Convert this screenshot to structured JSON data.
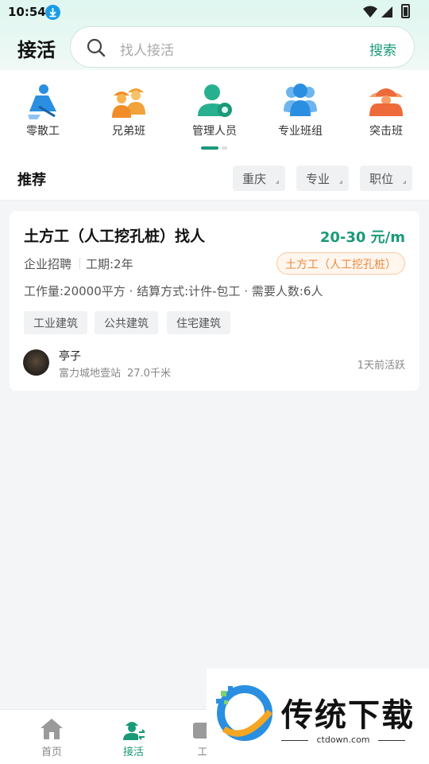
{
  "status_bar": {
    "time": "10:54"
  },
  "header": {
    "title": "接活",
    "search_placeholder": "找人接活",
    "search_button": "搜索"
  },
  "categories": [
    {
      "label": "零散工",
      "icon": "digging-worker-icon"
    },
    {
      "label": "兄弟班",
      "icon": "worker-group-icon"
    },
    {
      "label": "管理人员",
      "icon": "manager-icon"
    },
    {
      "label": "专业班组",
      "icon": "team-icon"
    },
    {
      "label": "突击班",
      "icon": "helmet-crew-icon"
    }
  ],
  "filter_bar": {
    "title": "推荐",
    "filters": [
      "重庆",
      "专业",
      "职位"
    ]
  },
  "job": {
    "title": "土方工（人工挖孔桩）找人",
    "salary": "20-30 元/m",
    "source": "企业招聘",
    "period": "工期:2年",
    "trade": "土方工（人工挖孔桩）",
    "details": "工作量:20000平方 · 结算方式:计件-包工 · 需要人数:6人",
    "tags": [
      "工业建筑",
      "公共建筑",
      "住宅建筑"
    ],
    "poster": {
      "name": "亭子",
      "location": "富力城地壹站",
      "distance": "27.0千米",
      "active": "1天前活跃"
    }
  },
  "bottom_nav": [
    {
      "label": "首页",
      "icon": "home-icon"
    },
    {
      "label": "接活",
      "icon": "worker-swap-icon"
    },
    {
      "label": "工",
      "icon": "work-icon"
    }
  ],
  "watermark": {
    "title": "传统下载",
    "url": "ctdown.com"
  },
  "colors": {
    "accent": "#1a9a78",
    "orange": "#ef8a3f",
    "blue": "#2a8fe0"
  }
}
